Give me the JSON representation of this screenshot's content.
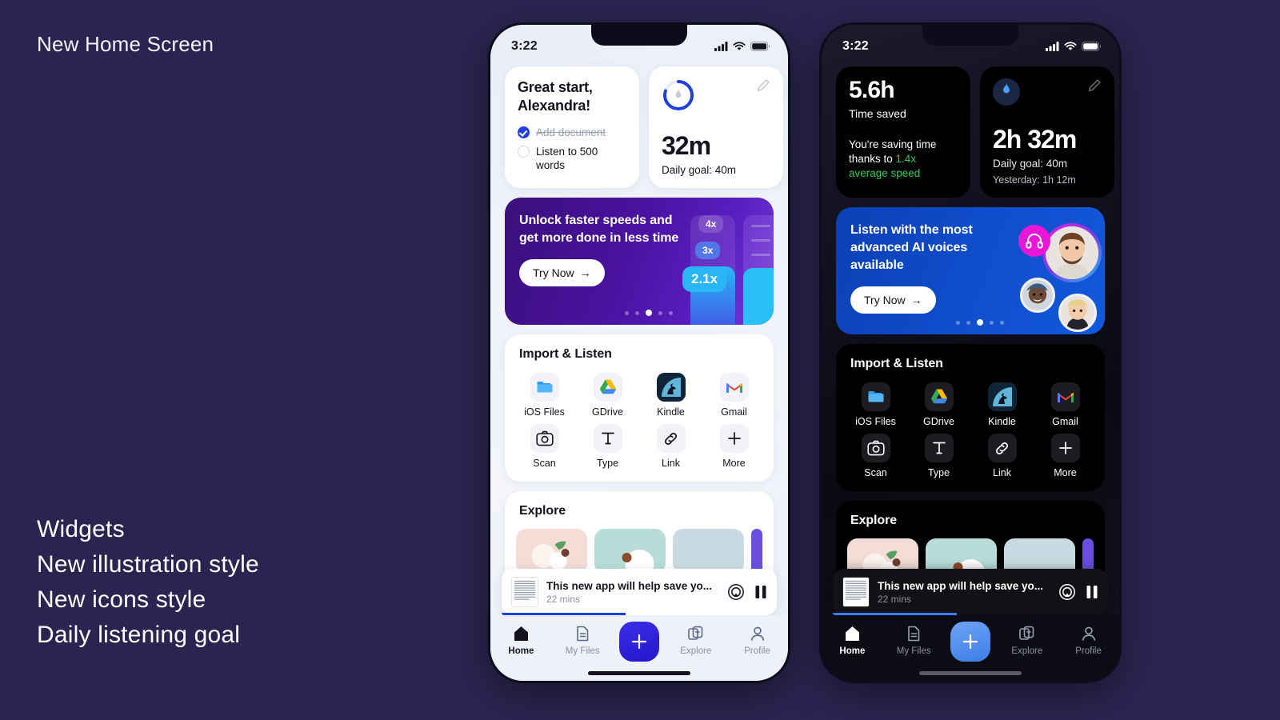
{
  "caption": {
    "title": "New Home Screen",
    "features": [
      "Widgets",
      "New illustration style",
      "New icons style",
      "Daily listening goal"
    ]
  },
  "status_bar": {
    "time": "3:22",
    "signal_icon": "cellular-signal-icon",
    "wifi_icon": "wifi-icon",
    "battery_icon": "battery-icon"
  },
  "light_phone": {
    "greeting_widget": {
      "title": "Great start, Alexandra!",
      "tasks": [
        {
          "label": "Add document",
          "done": true
        },
        {
          "label": "Listen to 500 words",
          "done": false
        }
      ]
    },
    "goal_widget": {
      "value": "32m",
      "subtitle": "Daily goal: 40m",
      "progress_percent": 80,
      "flame_icon": "flame-icon",
      "edit_icon": "pencil-icon"
    },
    "promo": {
      "title": "Unlock faster speeds and get more done in less time",
      "cta": "Try Now",
      "speed_badges": [
        "4x",
        "3x",
        "2.1x"
      ],
      "active_speed": "2.1x",
      "dots_total": 5,
      "dots_active_index": 2
    },
    "import": {
      "title": "Import & Listen",
      "items": [
        {
          "label": "iOS Files",
          "icon": "ios-files-icon"
        },
        {
          "label": "GDrive",
          "icon": "google-drive-icon"
        },
        {
          "label": "Kindle",
          "icon": "kindle-icon"
        },
        {
          "label": "Gmail",
          "icon": "gmail-icon"
        },
        {
          "label": "Scan",
          "icon": "camera-icon"
        },
        {
          "label": "Type",
          "icon": "text-type-icon"
        },
        {
          "label": "Link",
          "icon": "link-icon"
        },
        {
          "label": "More",
          "icon": "plus-icon"
        }
      ]
    },
    "explore": {
      "title": "Explore"
    },
    "player": {
      "title": "This new app will help save yo...",
      "duration": "22 mins",
      "airplay_icon": "airplay-icon",
      "pause_icon": "pause-icon",
      "progress_percent": 45
    },
    "tabs": [
      {
        "label": "Home",
        "icon": "home-icon",
        "active": true
      },
      {
        "label": "My Files",
        "icon": "document-icon",
        "active": false
      },
      {
        "label": "Explore",
        "icon": "cards-icon",
        "active": false
      },
      {
        "label": "Profile",
        "icon": "person-icon",
        "active": false
      }
    ],
    "fab_icon": "plus-icon"
  },
  "dark_phone": {
    "time_saved_widget": {
      "value": "5.6h",
      "label": "Time saved",
      "description_prefix": "You're saving time thanks to ",
      "description_accent": "1.4x average speed",
      "accent_color": "#2ecc5a"
    },
    "goal_widget": {
      "value": "2h 32m",
      "subtitle": "Daily goal: 40m",
      "yesterday": "Yesterday: 1h 12m",
      "flame_icon": "flame-icon",
      "edit_icon": "pencil-icon"
    },
    "promo": {
      "title": "Listen with the most advanced AI voices available",
      "cta": "Try Now",
      "headphones_icon": "headphones-icon",
      "dots_total": 5,
      "dots_active_index": 2
    },
    "import": {
      "title": "Import & Listen",
      "items": [
        {
          "label": "iOS Files",
          "icon": "ios-files-icon"
        },
        {
          "label": "GDrive",
          "icon": "google-drive-icon"
        },
        {
          "label": "Kindle",
          "icon": "kindle-icon"
        },
        {
          "label": "Gmail",
          "icon": "gmail-icon"
        },
        {
          "label": "Scan",
          "icon": "camera-icon"
        },
        {
          "label": "Type",
          "icon": "text-type-icon"
        },
        {
          "label": "Link",
          "icon": "link-icon"
        },
        {
          "label": "More",
          "icon": "plus-icon"
        }
      ]
    },
    "explore": {
      "title": "Explore"
    },
    "player": {
      "title": "This new app will help save yo...",
      "duration": "22 mins",
      "airplay_icon": "airplay-icon",
      "pause_icon": "pause-icon",
      "progress_percent": 45
    },
    "tabs": [
      {
        "label": "Home",
        "icon": "home-icon",
        "active": true
      },
      {
        "label": "My Files",
        "icon": "document-icon",
        "active": false
      },
      {
        "label": "Explore",
        "icon": "cards-icon",
        "active": false
      },
      {
        "label": "Profile",
        "icon": "person-icon",
        "active": false
      }
    ],
    "fab_icon": "plus-icon"
  },
  "colors": {
    "page_background": "#2a2550",
    "promo_purple": "#4912a0",
    "promo_blue": "#0f4cc9",
    "accent_blue": "#2140e0",
    "accent_cyan": "#29b6f6",
    "accent_green": "#2ecc5a",
    "accent_magenta": "#e916d8"
  }
}
